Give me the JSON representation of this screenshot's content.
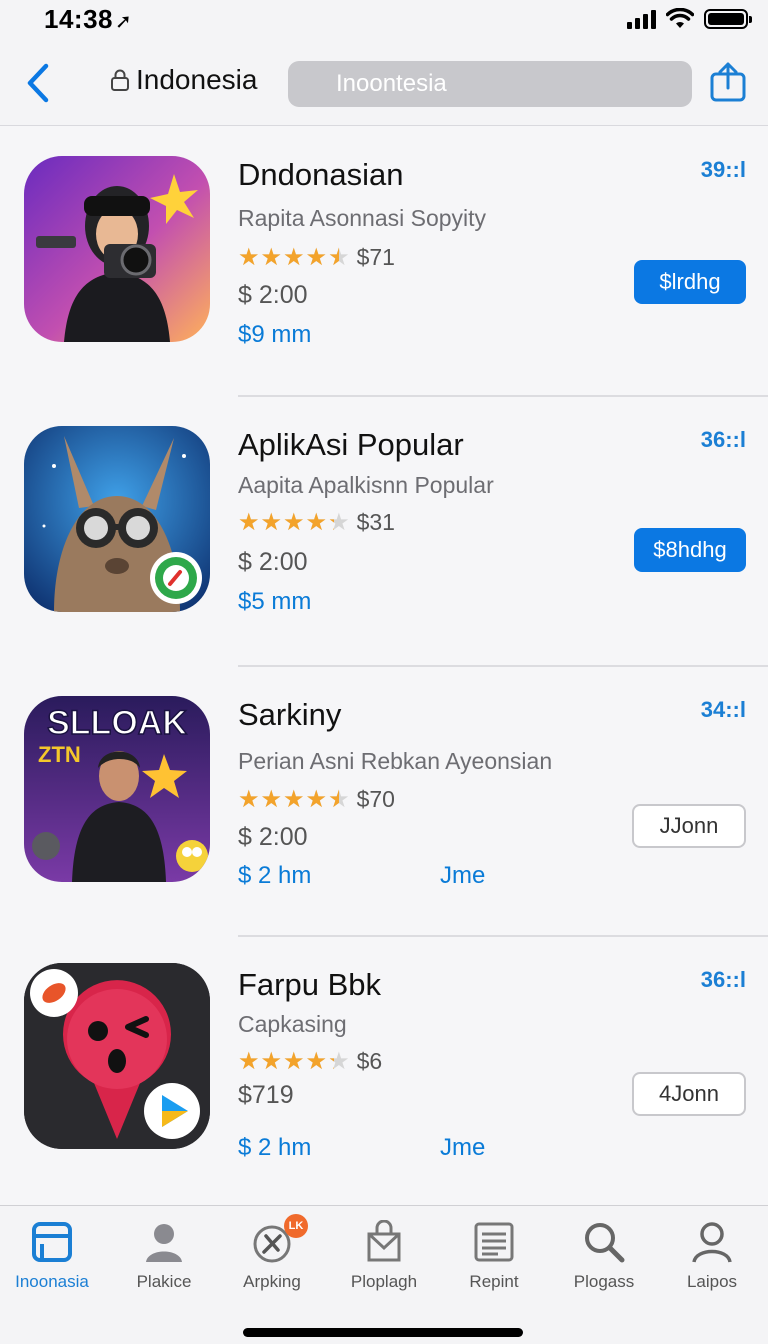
{
  "status_bar": {
    "time": "14:38",
    "location_glyph": "➚"
  },
  "nav": {
    "back_icon": "chevron-left-icon",
    "lock_icon": "lock-icon",
    "title": "Indonesia",
    "search_placeholder": "Inoontesia",
    "share_icon": "share-icon"
  },
  "apps": [
    {
      "name": "Dndonasian",
      "subtitle": "Rapita Asonnasi Sopyity",
      "rating_fraction": 0.9,
      "rating_text": "$71",
      "price": "$ 2:00",
      "size": "$9 mm",
      "extra": "",
      "rank": "39::l",
      "button_label": "$lrdhg",
      "button_style": "primary",
      "icon_name": "photographer-app-icon"
    },
    {
      "name": "AplikAsi Popular",
      "subtitle": "Aapita Apalkisnn Popular",
      "rating_fraction": 0.85,
      "rating_text": "$31",
      "price": "$ 2:00",
      "size": "$5 mm",
      "extra": "",
      "rank": "36::l",
      "button_label": "$8hdhg",
      "button_style": "primary",
      "icon_name": "kangaroo-goggles-app-icon"
    },
    {
      "name": "Sarkiny",
      "subtitle": "Perian Asni Rebkan Ayeonsian",
      "rating_fraction": 0.9,
      "rating_text": "$70",
      "price": "$ 2:00",
      "size": "$ 2 hm",
      "extra": "Jme",
      "rank": "34::l",
      "button_label": "JJonn",
      "button_style": "outline",
      "icon_name": "game-poster-app-icon",
      "icon_text_top": "SLLOAK",
      "icon_text_side": "ZTN"
    },
    {
      "name": "Farpu Bbk",
      "subtitle": "Capkasing",
      "rating_fraction": 0.85,
      "rating_text": "$6",
      "price": "$719",
      "size": "$ 2 hm",
      "extra": "Jme",
      "rank": "36::l",
      "button_label": "4Jonn",
      "button_style": "outline",
      "icon_name": "angry-face-pin-app-icon"
    }
  ],
  "tabs": [
    {
      "label": "Inoonasia",
      "icon": "today-icon",
      "active": true
    },
    {
      "label": "Plakice",
      "icon": "person-icon",
      "active": false
    },
    {
      "label": "Arpking",
      "icon": "tools-icon",
      "active": false,
      "badge": "LK"
    },
    {
      "label": "Ploplagh",
      "icon": "bag-icon",
      "active": false
    },
    {
      "label": "Repint",
      "icon": "document-icon",
      "active": false
    },
    {
      "label": "Plogass",
      "icon": "search-icon",
      "active": false
    },
    {
      "label": "Laipos",
      "icon": "account-icon",
      "active": false
    }
  ],
  "colors": {
    "accent": "#0b78e3",
    "star": "#f3a32b",
    "rank": "#1b7fd4",
    "badge": "#f06a2c"
  }
}
